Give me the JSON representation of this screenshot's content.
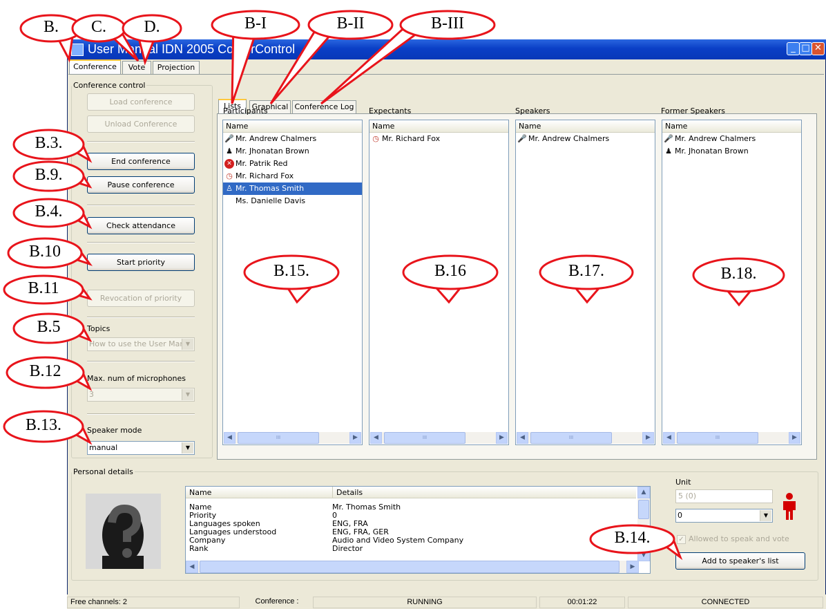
{
  "window": {
    "title": "User Manual IDN 2005 ConferControl",
    "controls": {
      "minimize": "_",
      "maximize": "□",
      "close": "✕"
    }
  },
  "main_tabs": [
    {
      "label": "Conference",
      "active": true
    },
    {
      "label": "Vote",
      "active": false
    },
    {
      "label": "Projection",
      "active": false
    }
  ],
  "conference_control": {
    "legend": "Conference control",
    "buttons": {
      "load": {
        "label": "Load conference",
        "enabled": false
      },
      "unload": {
        "label": "Unload Conference",
        "enabled": false
      },
      "end": {
        "label": "End conference",
        "enabled": true
      },
      "pause": {
        "label": "Pause conference",
        "enabled": true
      },
      "check": {
        "label": "Check attendance",
        "enabled": true
      },
      "start_priority": {
        "label": "Start priority",
        "enabled": true
      },
      "revocation": {
        "label": "Revocation of priority",
        "enabled": false
      }
    },
    "topics": {
      "label": "Topics",
      "value": "How to use the User Mar"
    },
    "max_mics": {
      "label": "Max. num of microphones",
      "value": "3"
    },
    "speaker_mode": {
      "label": "Speaker mode",
      "value": "manual"
    }
  },
  "sub_tabs": [
    {
      "label": "Lists",
      "active": true
    },
    {
      "label": "Graphical",
      "active": false
    },
    {
      "label": "Conference Log",
      "active": false
    }
  ],
  "panels": {
    "participants": {
      "title": "Participants",
      "column": "Name",
      "rows": [
        {
          "name": "Mr. Andrew Chalmers",
          "icon": "microphone-speaking-icon"
        },
        {
          "name": "Mr. Jhonatan Brown",
          "icon": "person-former-speaker-icon"
        },
        {
          "name": "Mr. Patrik Red",
          "icon": "red-x-icon"
        },
        {
          "name": "Mr. Richard Fox",
          "icon": "clock-waiting-icon"
        },
        {
          "name": "Mr. Thomas Smith",
          "icon": "person-icon",
          "selected": true
        },
        {
          "name": "Ms. Danielle Davis",
          "icon": ""
        }
      ]
    },
    "expectants": {
      "title": "Expectants",
      "column": "Name",
      "rows": [
        {
          "name": "Mr. Richard Fox",
          "icon": "clock-waiting-icon"
        }
      ]
    },
    "speakers": {
      "title": "Speakers",
      "column": "Name",
      "rows": [
        {
          "name": "Mr. Andrew Chalmers",
          "icon": "microphone-speaking-icon"
        }
      ]
    },
    "former_speakers": {
      "title": "Former Speakers",
      "column": "Name",
      "rows": [
        {
          "name": "Mr. Andrew Chalmers",
          "icon": "microphone-speaking-icon"
        },
        {
          "name": "Mr. Jhonatan Brown",
          "icon": "person-former-speaker-icon"
        }
      ]
    },
    "scroll_thumb_glyph": "III"
  },
  "personal_details": {
    "legend": "Personal details",
    "columns": [
      "Name",
      "Details"
    ],
    "rows": [
      [
        "Name",
        "Mr. Thomas Smith"
      ],
      [
        "Priority",
        "0"
      ],
      [
        "Languages spoken",
        "ENG, FRA"
      ],
      [
        "Languages understood",
        "ENG, FRA, GER"
      ],
      [
        "Company",
        "Audio and Video System Company"
      ],
      [
        "Rank",
        "Director"
      ]
    ],
    "unit_label": "Unit",
    "unit_value": "5 (0)",
    "unit_select": "0",
    "allowed_label": "Allowed to speak and vote",
    "add_button": "Add to speaker's list"
  },
  "status_bar": {
    "free_channels": "Free channels: 2",
    "conference_label": "Conference :",
    "state": "RUNNING",
    "time": "00:01:22",
    "connection": "CONNECTED"
  },
  "callouts": {
    "b": "B.",
    "c": "C.",
    "d": "D.",
    "bi": "B-I",
    "bii": "B-II",
    "biii": "B-III",
    "b3": "B.3.",
    "b9": "B.9.",
    "b4": "B.4.",
    "b10": "B.10",
    "b11": "B.11",
    "b5": "B.5",
    "b12": "B.12",
    "b13": "B.13.",
    "b14": "B.14.",
    "b15": "B.15.",
    "b16": "B.16",
    "b17": "B.17.",
    "b18": "B.18."
  },
  "colors": {
    "callout_red": "#e8141b",
    "selection_blue": "#316ac5",
    "titlebar_blue": "#0a3fc6"
  }
}
